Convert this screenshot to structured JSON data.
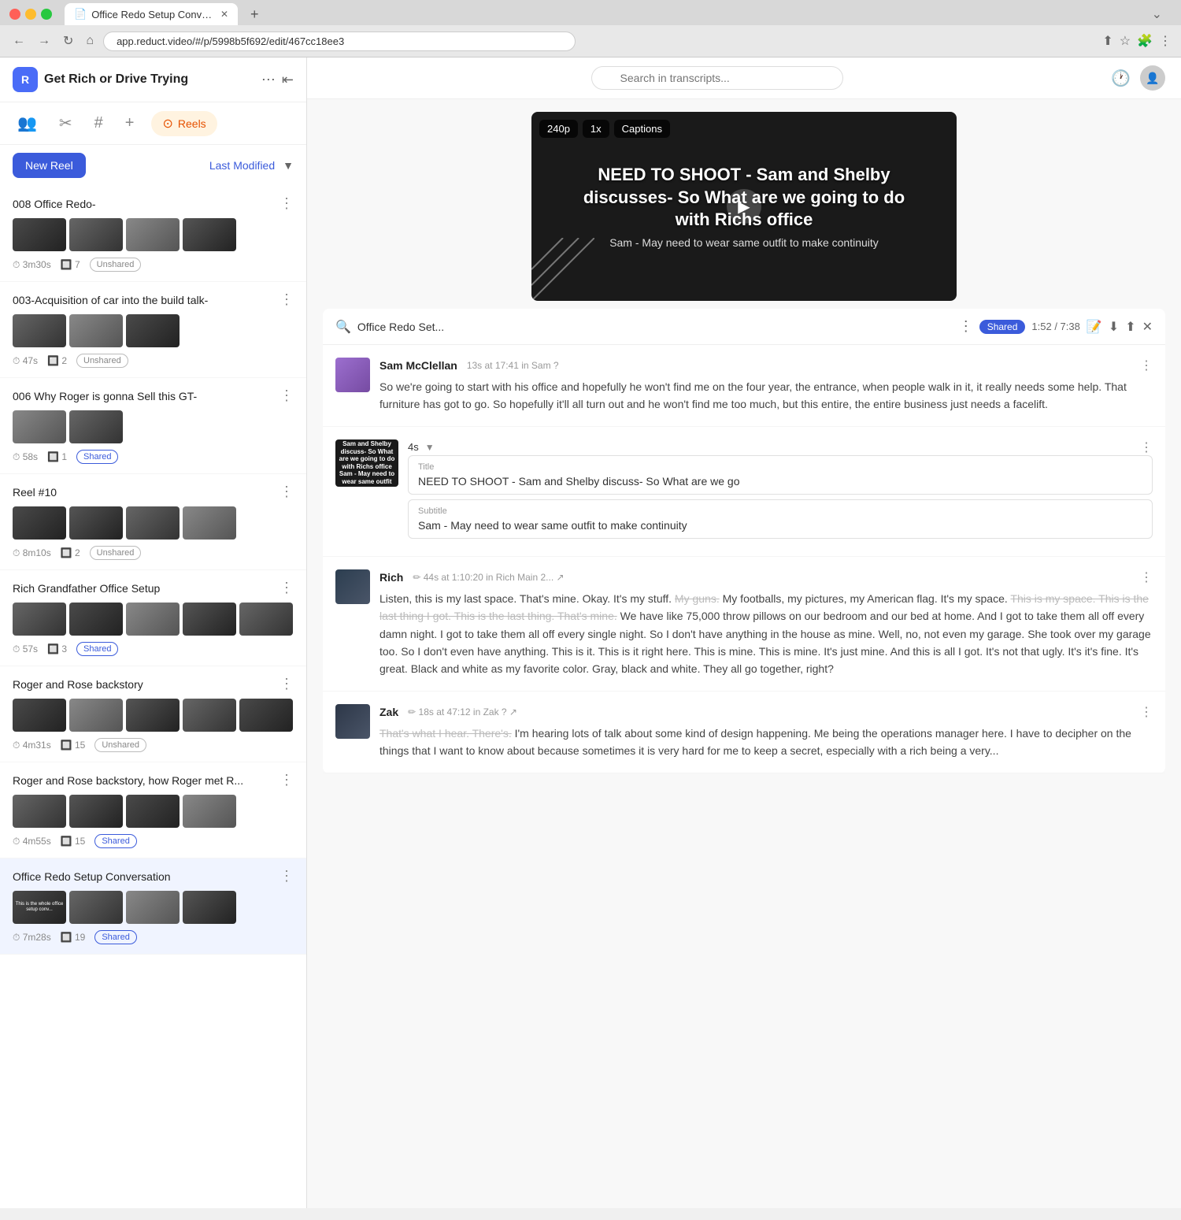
{
  "browser": {
    "tab_title": "Office Redo Setup Conversati...",
    "url": "app.reduct.video/#/p/5998b5f692/edit/467cc18ee3",
    "tab_favicon": "📄"
  },
  "sidebar": {
    "logo_text": "R",
    "project_title": "Get Rich or Drive Trying",
    "nav_items": [
      {
        "id": "people",
        "icon": "👥"
      },
      {
        "id": "edit",
        "icon": "✏️"
      },
      {
        "id": "tag",
        "icon": "#"
      },
      {
        "id": "add",
        "icon": "+"
      }
    ],
    "reels_btn": "Reels",
    "new_reel_btn": "New Reel",
    "sort_label": "Last Modified",
    "reels": [
      {
        "id": 1,
        "title": "008 Office Redo-",
        "duration": "3m30s",
        "clips": 7,
        "status": "Unshared",
        "shared": false
      },
      {
        "id": 2,
        "title": "003-Acquisition of car into the build talk-",
        "duration": "47s",
        "clips": 2,
        "status": "Unshared",
        "shared": false
      },
      {
        "id": 3,
        "title": "006 Why Roger is gonna Sell this GT-",
        "duration": "58s",
        "clips": 1,
        "status": "Shared",
        "shared": true
      },
      {
        "id": 4,
        "title": "Reel #10",
        "duration": "8m10s",
        "clips": 2,
        "status": "Unshared",
        "shared": false
      },
      {
        "id": 5,
        "title": "Rich Grandfather Office Setup",
        "duration": "57s",
        "clips": 3,
        "status": "Shared",
        "shared": true
      },
      {
        "id": 6,
        "title": "Roger and Rose backstory",
        "duration": "4m31s",
        "clips": 15,
        "status": "Unshared",
        "shared": false
      },
      {
        "id": 7,
        "title": "Roger and Rose backstory, how Roger met R...",
        "duration": "4m55s",
        "clips": 15,
        "status": "Shared",
        "shared": true
      },
      {
        "id": 8,
        "title": "Office Redo Setup Conversation",
        "duration": "7m28s",
        "clips": 19,
        "status": "Shared",
        "shared": true,
        "active": true
      }
    ]
  },
  "search": {
    "placeholder": "Search in transcripts..."
  },
  "video": {
    "quality": "240p",
    "speed": "1x",
    "captions_label": "Captions",
    "overlay_title": "NEED TO SHOOT - Sam and Shelby discusses- So What are we going to do with Richs office",
    "subtitle": "Sam - May need to wear same outfit to make continuity"
  },
  "transcript_panel": {
    "title": "Office Redo Set...",
    "shared_badge": "Shared",
    "time": "1:52 / 7:38",
    "entries": [
      {
        "id": "sam",
        "name": "Sam McClellan",
        "meta": "13s at 17:41 in Sam ?",
        "avatar_color": "#7c6fcf",
        "text": "So we're going to start with his office and hopefully he won't find me on the four year, the entrance, when people walk in it, it really needs some help. That furniture has got to go. So hopefully it'll all turn out and he won't find me too much, but this entire, the entire business just needs a facelift."
      },
      {
        "id": "title-card",
        "type": "title",
        "thumb_text": "NEED TO SHOOT - Sam and Shelby discuss- So What are we going to do with Richs office\nSam - May need to wear same outfit to make continuity",
        "title_label": "Title",
        "title_value": "NEED TO SHOOT - Sam and Shelby discuss- So What are we go",
        "subtitle_label": "Subtitle",
        "subtitle_value": "Sam - May need to wear same outfit to make continuity",
        "duration": "4s"
      },
      {
        "id": "rich",
        "name": "Rich",
        "meta": "44s at 1:10:20 in Rich Main 2... ↗",
        "avatar_color": "#3a4a5a",
        "text_normal": "Listen, this is my last space. That's mine. Okay. It's my stuff. ",
        "text_strikethrough1": "My guns.",
        "text_normal2": " My footballs, my pictures, my American flag. It's my space. ",
        "text_strikethrough2": "This is my space. This is the last thing I got. This is the last thing. That's mine.",
        "text_normal3": " We have like 75,000 throw pillows on our bedroom and our bed at home. And I got to take them all off every damn night. I got to take them all off every single night. So I don't have anything in the house as mine. Well, no, not even my garage. She took over my garage too. So I don't even have anything. This is it. This is it right here. This is mine. This is mine. It's just mine. And this is all I got. It's not that ugly. It's it's fine. It's great. Black and white as my favorite color. Gray, black and white. They all go together, right?"
      },
      {
        "id": "zak",
        "name": "Zak",
        "meta": "18s at 47:12 in Zak ? ↗",
        "avatar_color": "#2d3748",
        "text_normal": "",
        "text_strikethrough1": "That's what I hear. There's.",
        "text_normal2": " I'm hearing lots of talk about some kind of design happening. Me being the operations manager here. I have to decipher on the things that I want to know about because sometimes it is very hard for me to keep a secret, especially with a rich being a very..."
      }
    ]
  }
}
